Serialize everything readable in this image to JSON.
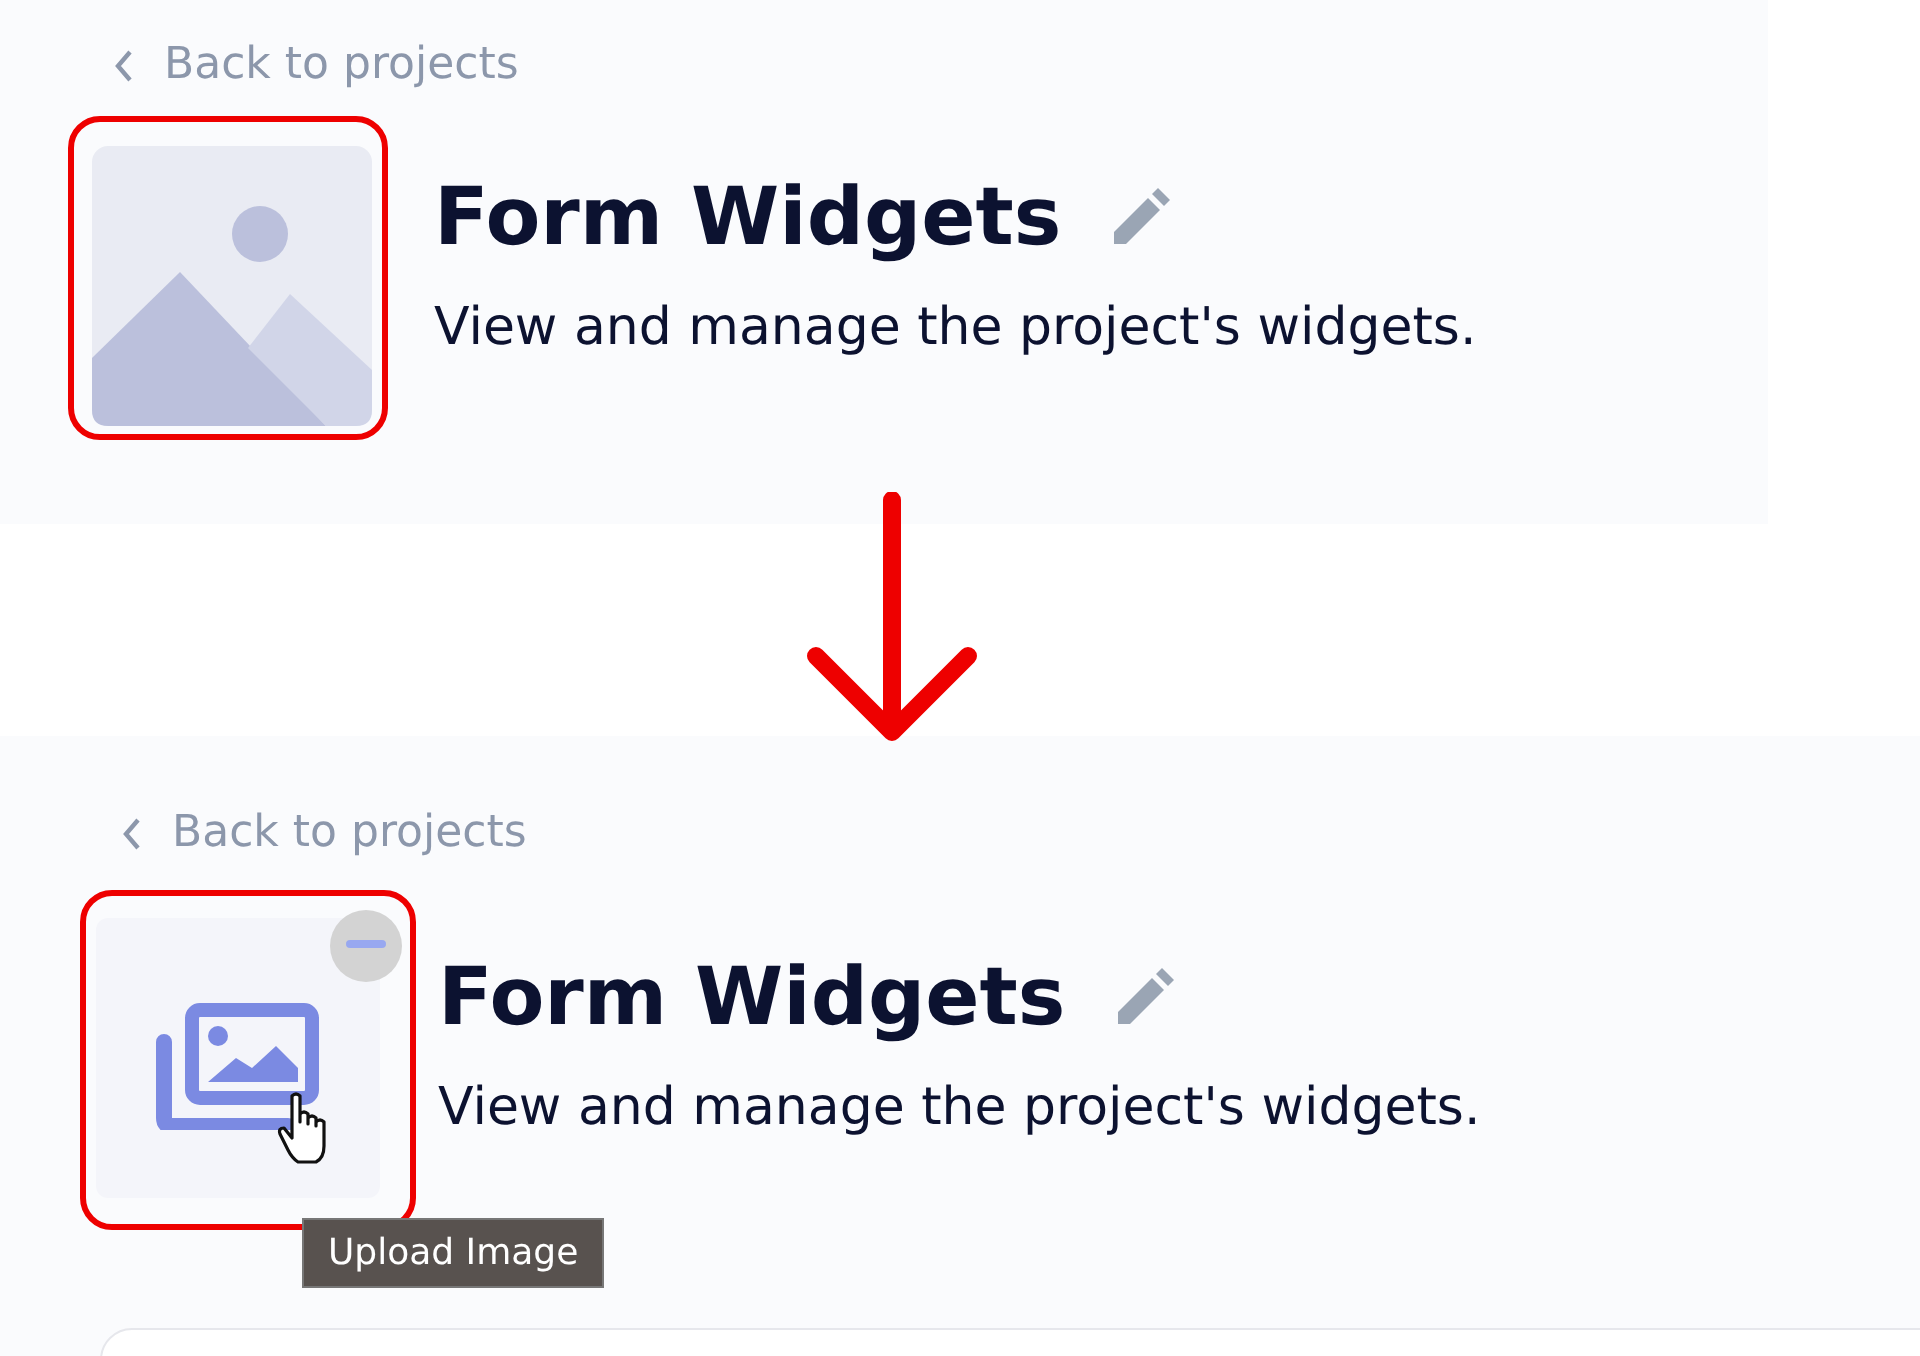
{
  "panels": [
    {
      "kind": "default",
      "back_link": "Back to projects",
      "title": "Form Widgets",
      "description": "View and manage the project's widgets."
    },
    {
      "kind": "hover",
      "back_link": "Back to projects",
      "title": "Form Widgets",
      "description": "View and manage the project's widgets.",
      "tooltip": "Upload Image"
    }
  ]
}
